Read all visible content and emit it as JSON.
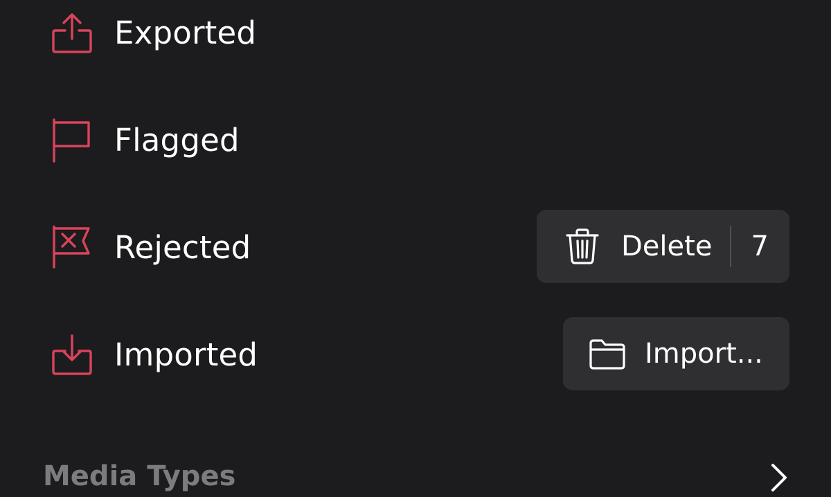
{
  "colors": {
    "background": "#1c1c1e",
    "accent": "#d9445b",
    "pill_background": "#2f2f31",
    "text": "#ffffff",
    "section_header": "#7b7b80"
  },
  "items": [
    {
      "label": "Exported",
      "icon": "export-icon"
    },
    {
      "label": "Flagged",
      "icon": "flag-icon"
    },
    {
      "label": "Rejected",
      "icon": "rejected-flag-icon"
    },
    {
      "label": "Imported",
      "icon": "import-icon"
    }
  ],
  "delete_button": {
    "icon": "trash-icon",
    "label": "Delete",
    "count": "7"
  },
  "import_button": {
    "icon": "folder-icon",
    "label": "Import..."
  },
  "section": {
    "title": "Media Types",
    "icon": "chevron-right-icon"
  }
}
